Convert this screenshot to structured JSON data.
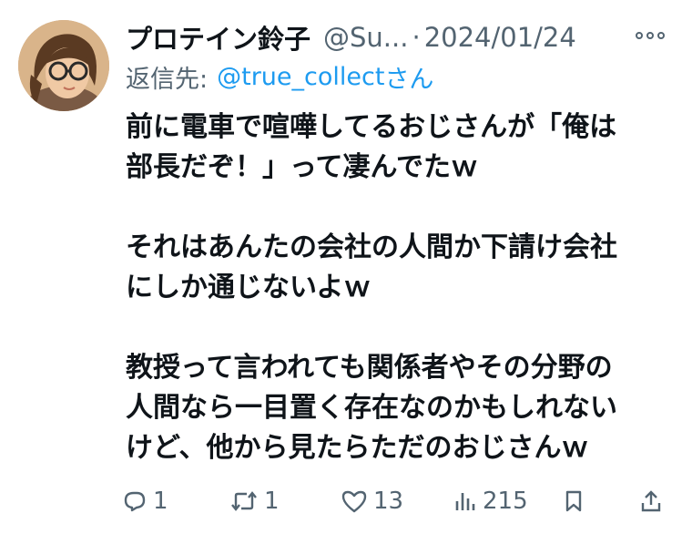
{
  "tweet": {
    "author": {
      "display_name": "プロテイン鈴子",
      "handle": "@Su...",
      "avatar_icon": "avatar-icon"
    },
    "separator": "·",
    "date": "2024/01/24",
    "reply": {
      "prefix": "返信先:",
      "target": "@true_collect",
      "suffix": "さん"
    },
    "body_lines": [
      "前に電車で喧嘩してるおじさんが「俺は",
      "部長だぞ！」って凄んでたｗ",
      "",
      "それはあんたの会社の人間か下請け会社",
      "にしか通じないよｗ",
      "",
      "教授って言われても関係者やその分野の",
      "人間なら一目置く存在なのかもしれない",
      "けど、他から見たらただのおじさんｗ"
    ],
    "stats": {
      "replies": "1",
      "retweets": "1",
      "likes": "13",
      "views": "215"
    }
  },
  "colors": {
    "text": "#0f1419",
    "secondary": "#536471",
    "link": "#1d9bf0"
  },
  "icons": [
    "more-icon",
    "reply-icon",
    "retweet-icon",
    "like-icon",
    "views-icon",
    "bookmark-icon",
    "share-icon"
  ]
}
